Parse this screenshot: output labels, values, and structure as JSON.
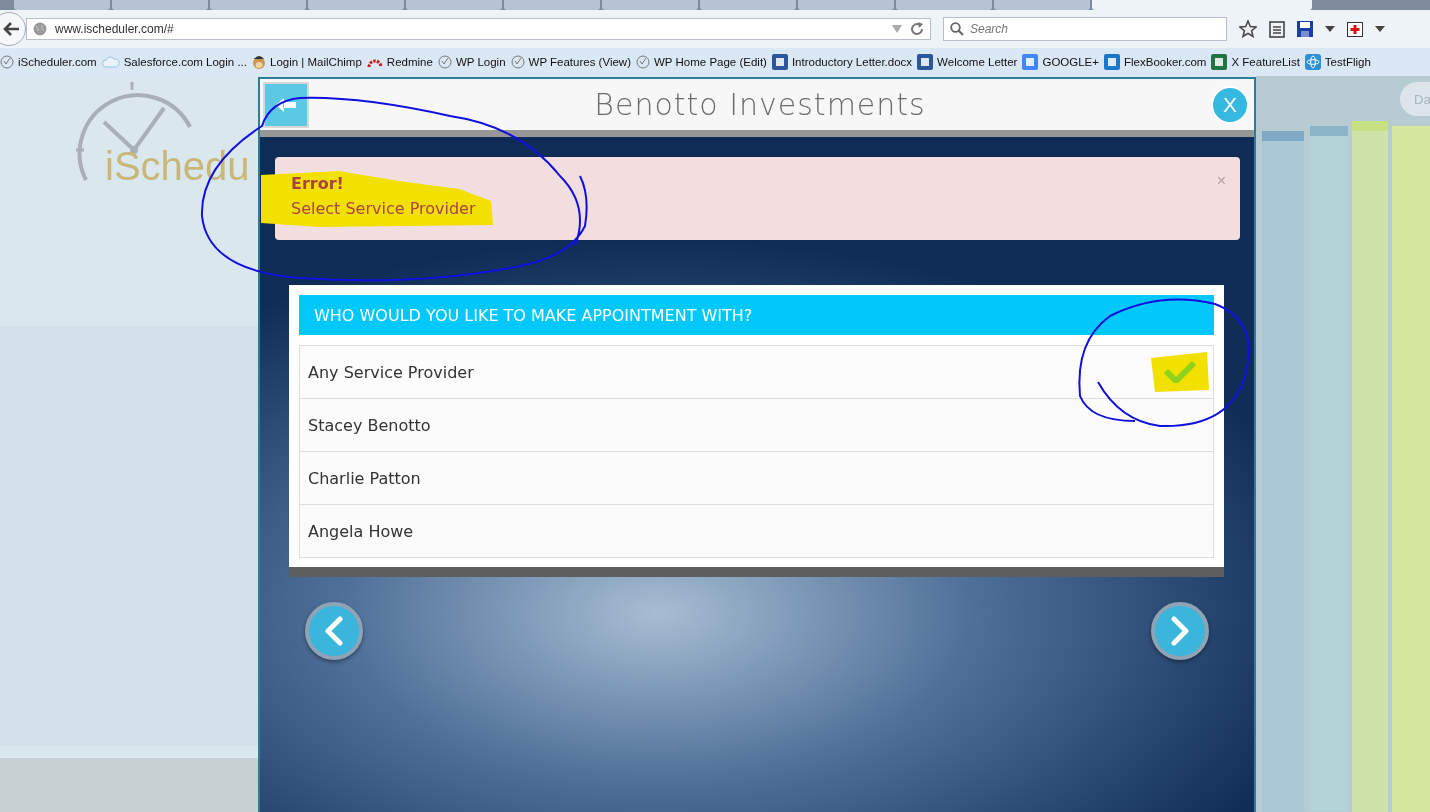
{
  "browser": {
    "tabs": [
      {
        "selected": false
      },
      {
        "selected": false
      },
      {
        "selected": false
      },
      {
        "selected": false
      },
      {
        "selected": false
      },
      {
        "selected": false
      },
      {
        "selected": false
      },
      {
        "selected": false
      },
      {
        "selected": false
      },
      {
        "selected": false
      },
      {
        "selected": false
      },
      {
        "selected": true
      }
    ],
    "address": "www.ischeduler.com/#",
    "search": {
      "placeholder": "Search"
    },
    "bookmarks": [
      {
        "label": "iScheduler.com",
        "kind": "clock"
      },
      {
        "label": "Salesforce.com Login ...",
        "kind": "cloud"
      },
      {
        "label": "Login | MailChimp",
        "kind": "monkey"
      },
      {
        "label": "Redmine",
        "kind": "arc"
      },
      {
        "label": "WP Login",
        "kind": "clock"
      },
      {
        "label": "WP Features (View)",
        "kind": "clock"
      },
      {
        "label": "WP Home Page (Edit)",
        "kind": "clock"
      },
      {
        "label": "Introductory Letter.docx",
        "kind": "word"
      },
      {
        "label": "Welcome Letter",
        "kind": "word"
      },
      {
        "label": "GOOGLE+",
        "kind": "google"
      },
      {
        "label": "FlexBooker.com",
        "kind": "flex"
      },
      {
        "label": "X FeatureList",
        "kind": "excel"
      },
      {
        "label": "TestFligh",
        "kind": "atom"
      }
    ]
  },
  "page": {
    "logo_text": "iSchedu",
    "side_button": "Da"
  },
  "modal": {
    "title": "Benotto Investments",
    "close_label": "X",
    "alert": {
      "heading": "Error!",
      "message": "Select Service Provider",
      "dismiss": "×"
    },
    "question": "WHO WOULD YOU LIKE TO MAKE APPOINTMENT WITH?",
    "providers": [
      {
        "name": "Any Service Provider",
        "selected": true
      },
      {
        "name": "Stacey Benotto",
        "selected": false
      },
      {
        "name": "Charlie Patton",
        "selected": false
      },
      {
        "name": "Angela Howe",
        "selected": false
      }
    ]
  }
}
